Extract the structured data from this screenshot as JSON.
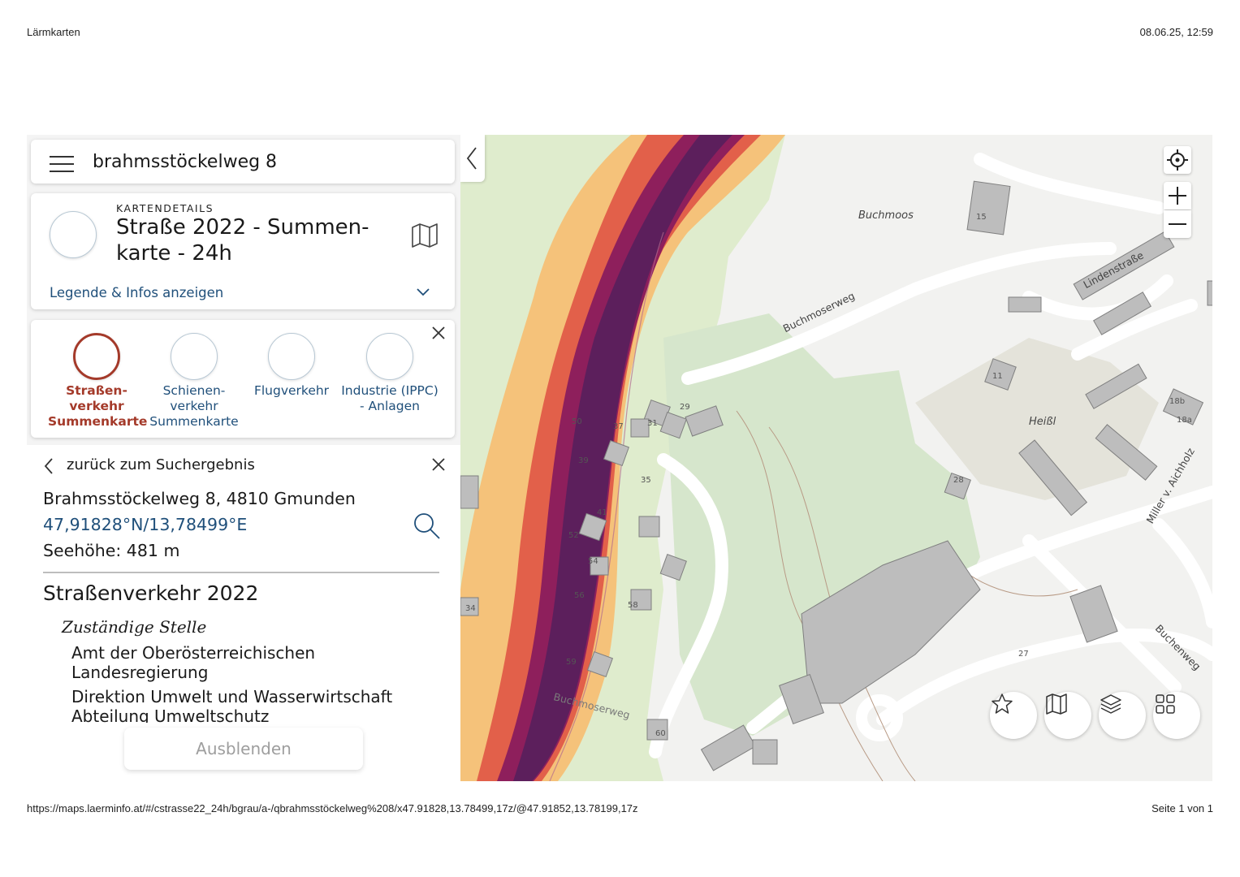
{
  "print_header": {
    "title": "Lärmkarten",
    "datetime": "08.06.25, 12:59"
  },
  "print_footer": {
    "url": "https://maps.laerminfo.at/#/cstrasse22_24h/bgrau/a-/qbrahmsstöckelweg%208/x47.91828,13.78499,17z/@47.91852,13.78199,17z",
    "page": "Seite 1 von 1"
  },
  "search": {
    "value": "brahmsstöckelweg 8"
  },
  "map_details": {
    "section_label": "KARTENDETAILS",
    "title": "Straße 2022 - Summen-karte - 24h",
    "legend_link": "Legende & Infos anzeigen"
  },
  "categories": [
    {
      "label": "Straßen-verkehr Summenkarte",
      "active": true
    },
    {
      "label": "Schienen-verkehr Summenkarte",
      "active": false
    },
    {
      "label": "Flugverkehr",
      "active": false
    },
    {
      "label": "Industrie (IPPC) - Anlagen",
      "active": false
    }
  ],
  "result": {
    "back_label": "zurück zum Suchergebnis",
    "address": "Brahmsstöckelweg 8, 4810 Gmunden",
    "coordinates": "47,91828°N/13,78499°E",
    "altitude": "Seehöhe: 481 m",
    "section_title": "Straßenverkehr 2022",
    "authority_heading": "Zuständige Stelle",
    "authority_lines": [
      "Amt der Oberösterreichischen",
      "Landesregierung",
      "Direktion Umwelt und Wasserwirtschaft",
      "Abteilung Umweltschutz"
    ],
    "hide_button": "Ausblenden"
  },
  "map": {
    "place_labels": [
      "Buchmoos",
      "Heißl"
    ],
    "street_labels": [
      "Buchmoserweg",
      "Lindenstraße",
      "Buchenweg",
      "Miller v. Aichholz",
      "Buchmoserweg"
    ],
    "house_numbers": [
      "15",
      "50",
      "37",
      "31",
      "29",
      "39",
      "35",
      "41",
      "52",
      "54",
      "56",
      "58",
      "59",
      "60",
      "11",
      "28",
      "27",
      "18b",
      "18a",
      "34"
    ],
    "noise_colors": [
      "#f5c27a",
      "#e2604a",
      "#8e1f5c",
      "#5c1f5c"
    ]
  },
  "colors": {
    "accent_link": "#1f4f7a",
    "active_category": "#a43a2a"
  }
}
